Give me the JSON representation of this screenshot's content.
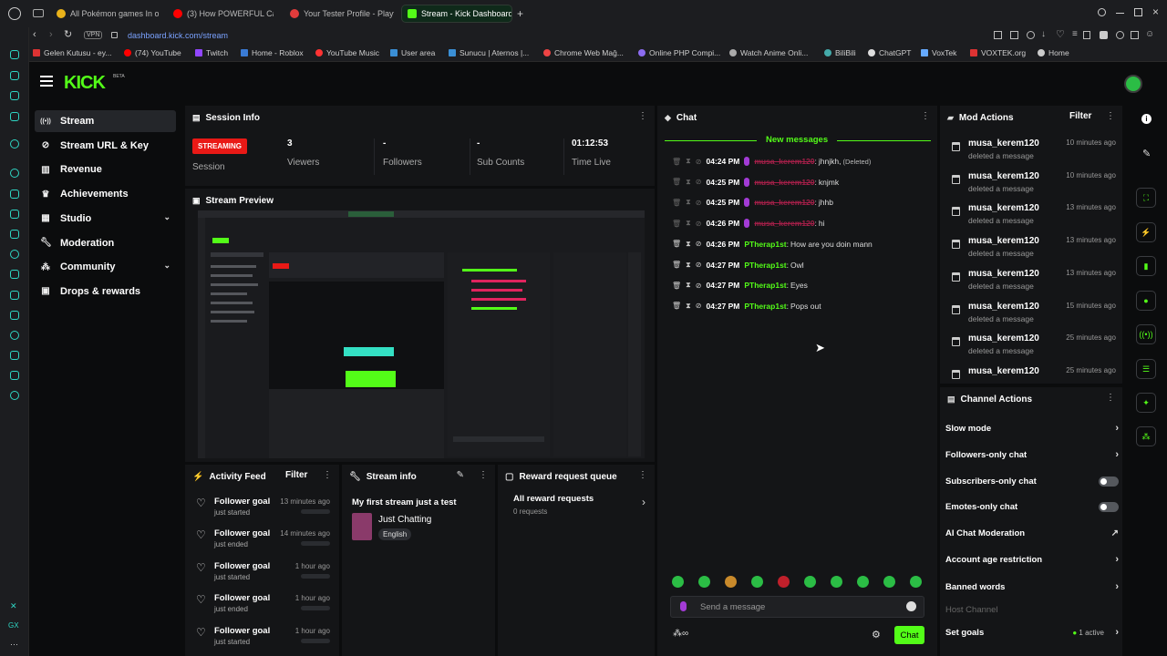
{
  "browser": {
    "tabs": [
      {
        "label": "All Pokémon games In ord..."
      },
      {
        "label": "(3) How POWERFUL Can..."
      },
      {
        "label": "Your Tester Profile - Playt..."
      },
      {
        "label": "Stream - Kick Dashboard"
      }
    ],
    "vpn": "VPN",
    "url_host": "dashboard.kick.com",
    "url_path": "/stream",
    "bookmarks": [
      "Gelen Kutusu - ey...",
      "(74) YouTube",
      "Twitch",
      "Home - Roblox",
      "YouTube Music",
      "User area",
      "Sunucu | Aternos |...",
      "Chrome Web Mağ...",
      "Online PHP Compi...",
      "Watch Anime Onli...",
      "BiliBili",
      "ChatGPT",
      "VoxTek",
      "VOXTEK.org",
      "Home"
    ]
  },
  "kick": {
    "logo": "KICK",
    "beta": "BETA",
    "nav": [
      {
        "label": "Stream",
        "icon": "radio-icon",
        "selected": true
      },
      {
        "label": "Stream URL & Key",
        "icon": "link-icon"
      },
      {
        "label": "Revenue",
        "icon": "chart-icon"
      },
      {
        "label": "Achievements",
        "icon": "trophy-icon"
      },
      {
        "label": "Studio",
        "icon": "grid-icon",
        "chevron": true
      },
      {
        "label": "Moderation",
        "icon": "wrench-icon"
      },
      {
        "label": "Community",
        "icon": "people-icon",
        "chevron": true
      },
      {
        "label": "Drops & rewards",
        "icon": "gift-icon"
      }
    ]
  },
  "session": {
    "title": "Session Info",
    "badge": "STREAMING",
    "badge_label": "Session",
    "stats": [
      {
        "value": "3",
        "label": "Viewers"
      },
      {
        "value": "-",
        "label": "Followers"
      },
      {
        "value": "-",
        "label": "Sub Counts"
      },
      {
        "value": "01:12:53",
        "label": "Time Live"
      }
    ]
  },
  "preview": {
    "title": "Stream Preview"
  },
  "chat": {
    "title": "Chat",
    "new_messages": "New messages",
    "messages": [
      {
        "time": "04:24 PM",
        "user": "musa_kerem120",
        "text": "jhnjkh,",
        "note": "(Deleted)",
        "deleted": true
      },
      {
        "time": "04:25 PM",
        "user": "musa_kerem120",
        "text": "knjmk",
        "deleted": true
      },
      {
        "time": "04:25 PM",
        "user": "musa_kerem120",
        "text": "jhhb",
        "deleted": true
      },
      {
        "time": "04:26 PM",
        "user": "musa_kerem120",
        "text": "hi",
        "deleted": true
      },
      {
        "time": "04:26 PM",
        "user": "PTherap1st",
        "text": "How are you doin mann"
      },
      {
        "time": "04:27 PM",
        "user": "PTherap1st",
        "text": "Owl"
      },
      {
        "time": "04:27 PM",
        "user": "PTherap1st",
        "text": "Eyes"
      },
      {
        "time": "04:27 PM",
        "user": "PTherap1st",
        "text": "Pops out"
      }
    ],
    "input_placeholder": "Send a message",
    "send_label": "Chat"
  },
  "mod_actions": {
    "title": "Mod Actions",
    "filter": "Filter",
    "items": [
      {
        "user": "musa_kerem120",
        "action": "deleted a message",
        "time": "10 minutes ago"
      },
      {
        "user": "musa_kerem120",
        "action": "deleted a message",
        "time": "10 minutes ago"
      },
      {
        "user": "musa_kerem120",
        "action": "deleted a message",
        "time": "13 minutes ago"
      },
      {
        "user": "musa_kerem120",
        "action": "deleted a message",
        "time": "13 minutes ago"
      },
      {
        "user": "musa_kerem120",
        "action": "deleted a message",
        "time": "13 minutes ago"
      },
      {
        "user": "musa_kerem120",
        "action": "deleted a message",
        "time": "15 minutes ago"
      },
      {
        "user": "musa_kerem120",
        "action": "deleted a message",
        "time": "25 minutes ago"
      },
      {
        "user": "musa_kerem120",
        "action": "",
        "time": "25 minutes ago"
      }
    ]
  },
  "channel_actions": {
    "title": "Channel Actions",
    "items": [
      {
        "label": "Slow mode",
        "control": "chevron"
      },
      {
        "label": "Followers-only chat",
        "control": "chevron"
      },
      {
        "label": "Subscribers-only chat",
        "control": "toggle"
      },
      {
        "label": "Emotes-only chat",
        "control": "toggle"
      },
      {
        "label": "AI Chat Moderation",
        "control": "external"
      },
      {
        "label": "Account age restriction",
        "control": "chevron"
      },
      {
        "label": "Banned words",
        "control": "chevron"
      }
    ],
    "host_channel": "Host Channel",
    "set_goals": "Set goals",
    "set_goals_status": "1 active"
  },
  "activity": {
    "title": "Activity Feed",
    "filter": "Filter",
    "items": [
      {
        "name": "Follower goal",
        "status": "just started",
        "time": "13 minutes ago"
      },
      {
        "name": "Follower goal",
        "status": "just ended",
        "time": "14 minutes ago"
      },
      {
        "name": "Follower goal",
        "status": "just started",
        "time": "1 hour ago"
      },
      {
        "name": "Follower goal",
        "status": "just ended",
        "time": "1 hour ago"
      },
      {
        "name": "Follower goal",
        "status": "just started",
        "time": "1 hour ago"
      }
    ]
  },
  "stream_info": {
    "title": "Stream info",
    "stream_title": "My first stream just a test",
    "category": "Just Chatting",
    "language": "English"
  },
  "rewards": {
    "title": "Reward request queue",
    "all": "All reward requests",
    "count": "0 requests"
  },
  "colors": {
    "accent": "#53fc18",
    "streaming": "#e91916",
    "deleted": "#e0245e"
  }
}
